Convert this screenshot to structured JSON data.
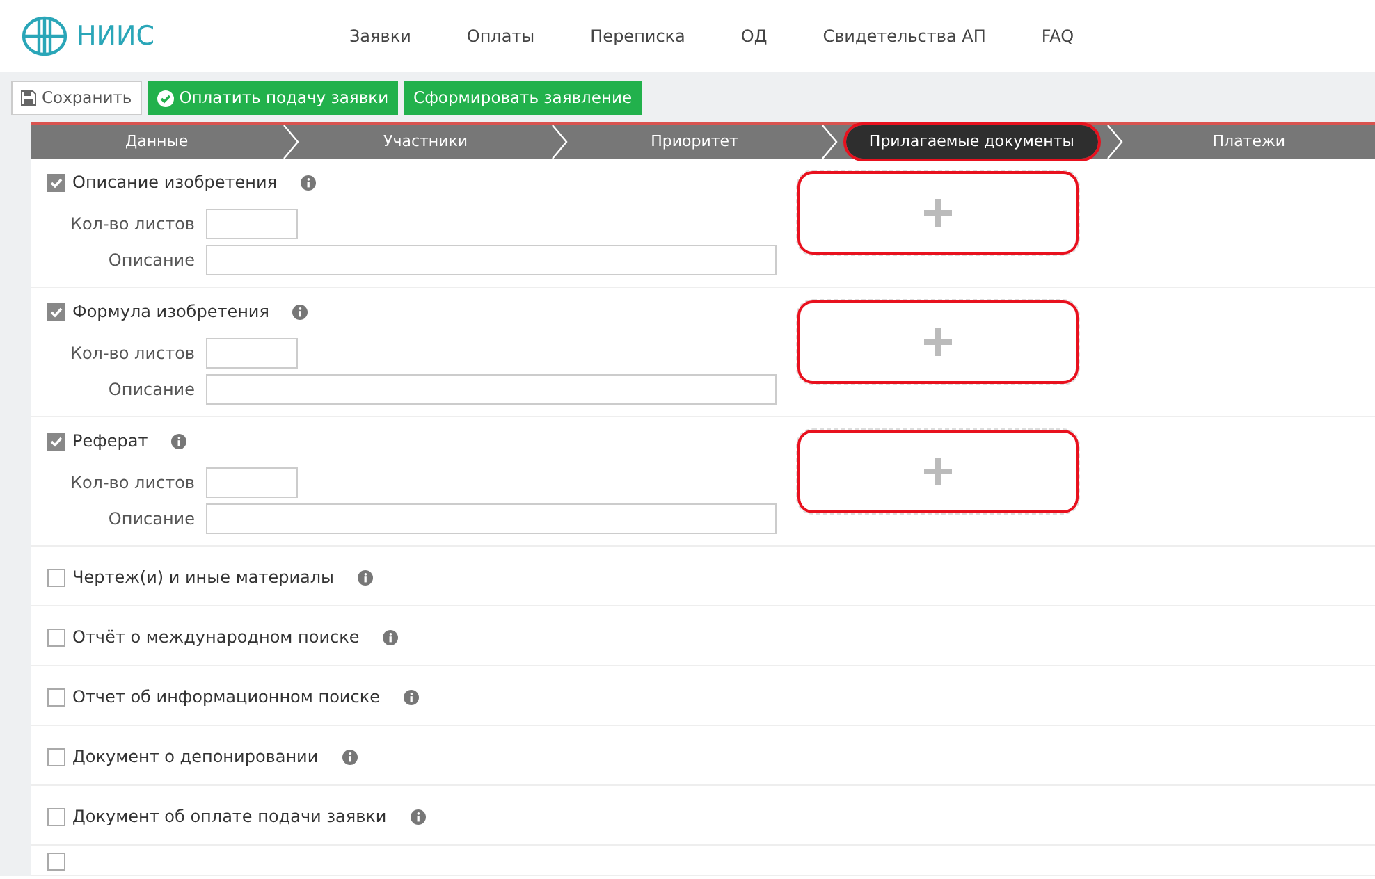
{
  "header": {
    "logo_text": "НИИС",
    "nav": [
      "Заявки",
      "Оплаты",
      "Переписка",
      "ОД",
      "Свидетельства АП",
      "FAQ"
    ]
  },
  "toolbar": [
    {
      "kind": "save",
      "label": "Сохранить"
    },
    {
      "kind": "pay",
      "label": "Оплатить подачу заявки"
    },
    {
      "kind": "plain",
      "label": "Сформировать заявление"
    }
  ],
  "steps": [
    {
      "label": "Данные",
      "selected": false,
      "highlighted": false
    },
    {
      "label": "Участники",
      "selected": false,
      "highlighted": false
    },
    {
      "label": "Приоритет",
      "selected": false,
      "highlighted": false
    },
    {
      "label": "Прилагаемые документы",
      "selected": true,
      "highlighted": true
    },
    {
      "label": "Платежи",
      "selected": false,
      "highlighted": false
    }
  ],
  "documents": [
    {
      "label": "Описание изобретения",
      "checked": true,
      "sheets_label": "Кол-во листов",
      "description_label": "Описание",
      "upload_highlighted": true
    },
    {
      "label": "Формула изобретения",
      "checked": true,
      "sheets_label": "Кол-во листов",
      "description_label": "Описание",
      "upload_highlighted": true
    },
    {
      "label": "Реферат",
      "checked": true,
      "sheets_label": "Кол-во листов",
      "description_label": "Описание",
      "upload_highlighted": true
    },
    {
      "label": "Чертеж(и) и иные материалы",
      "checked": false
    },
    {
      "label": "Отчёт о международном поиске",
      "checked": false
    },
    {
      "label": "Отчет об информационном поиске",
      "checked": false
    },
    {
      "label": "Документ о депонировании",
      "checked": false
    },
    {
      "label": "Документ об оплате подачи заявки",
      "checked": false
    },
    {
      "checked": false
    }
  ]
}
